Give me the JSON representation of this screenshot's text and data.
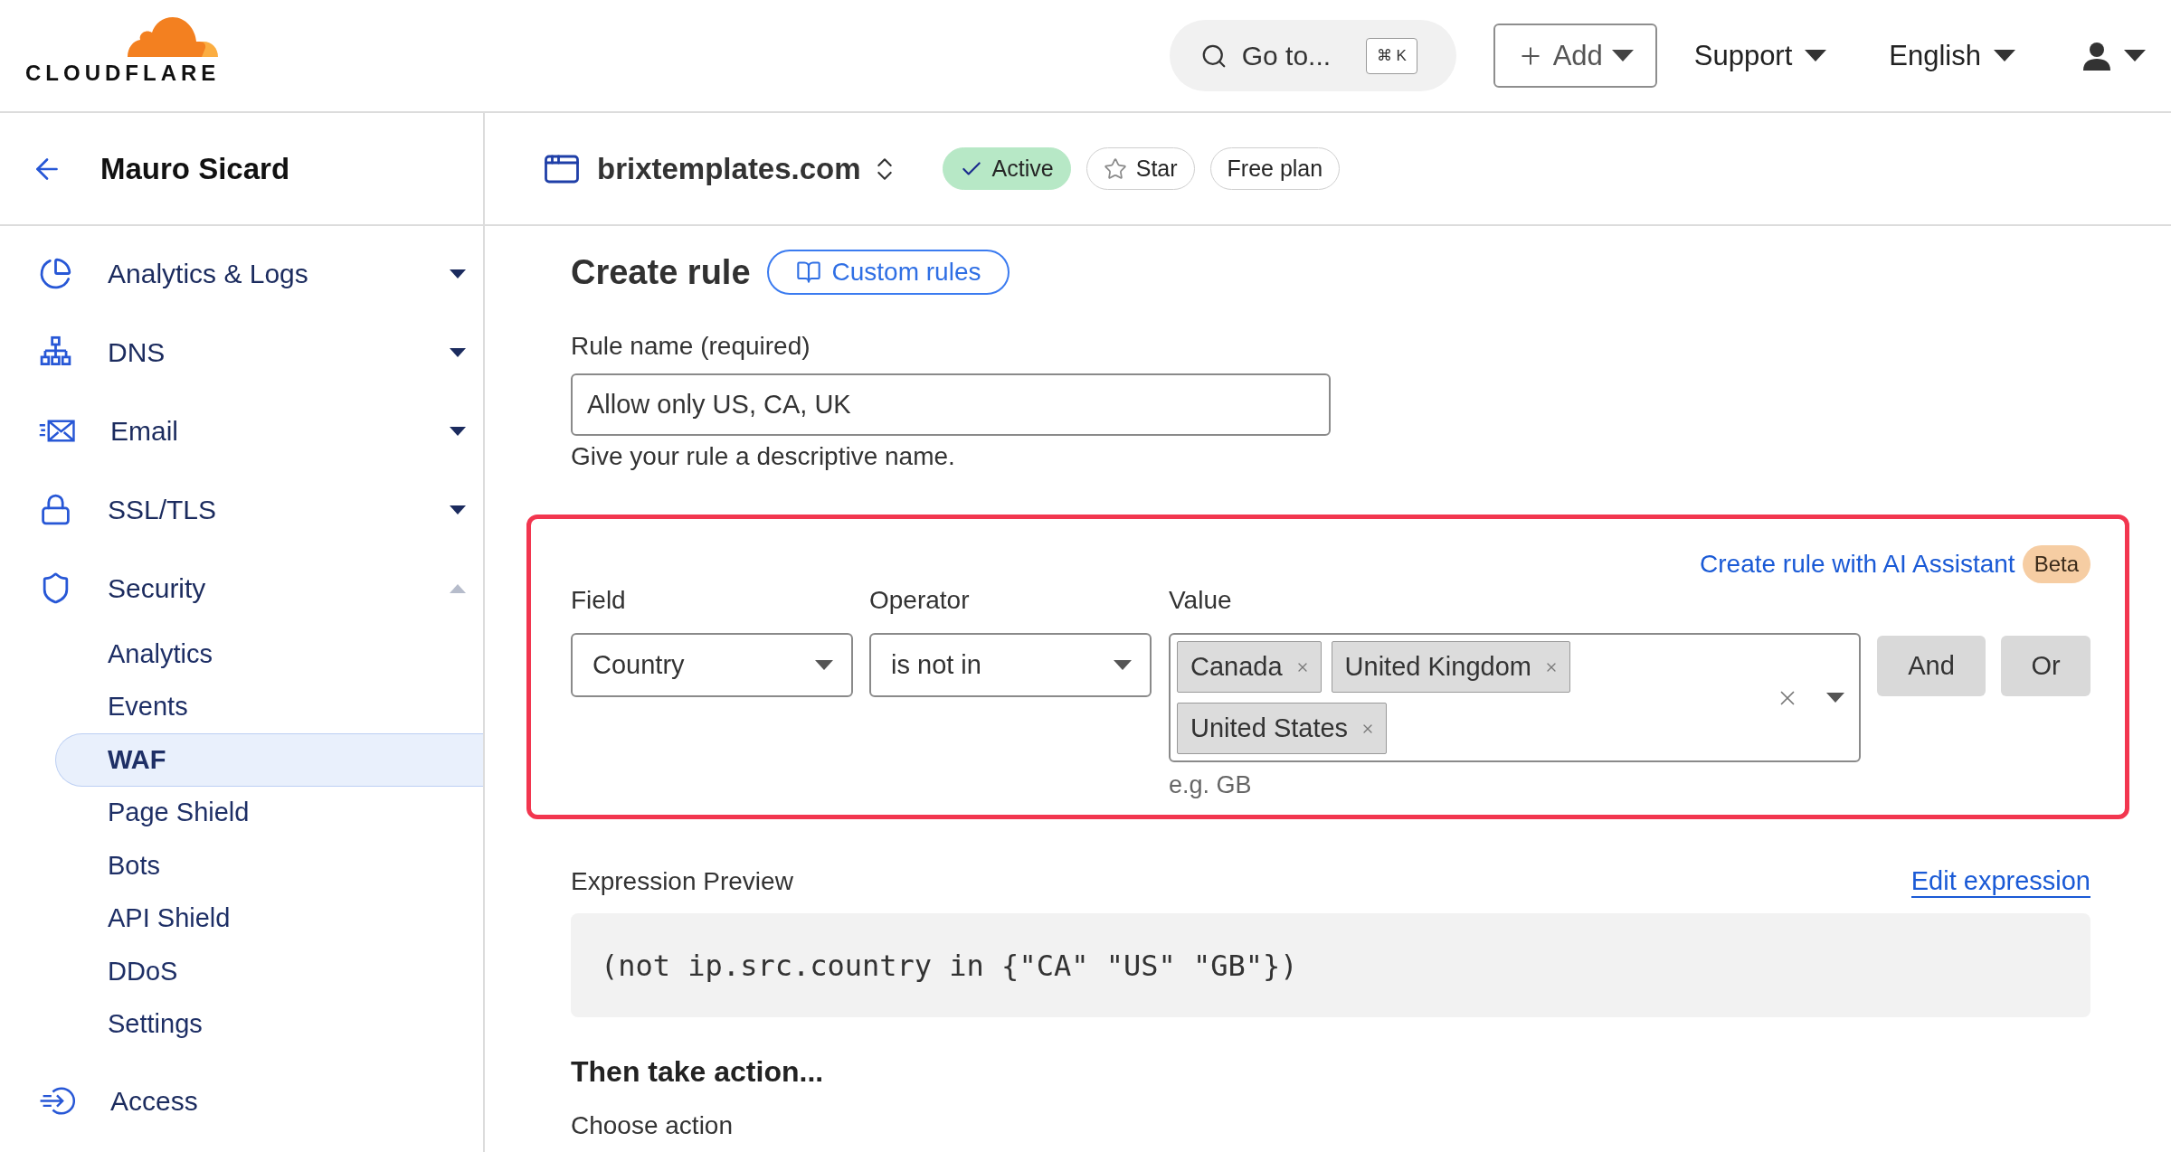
{
  "top_bar": {
    "logo_text": "CLOUDFLARE",
    "search": {
      "label": "Go to...",
      "shortcut": "⌘ K"
    },
    "add_button": "Add",
    "menus": [
      "Support",
      "English"
    ]
  },
  "sidebar": {
    "account": "Mauro Sicard",
    "items": [
      {
        "label": "Analytics & Logs",
        "expanded": false
      },
      {
        "label": "DNS",
        "expanded": false
      },
      {
        "label": "Email",
        "expanded": false
      },
      {
        "label": "SSL/TLS",
        "expanded": false
      },
      {
        "label": "Security",
        "expanded": true,
        "children": [
          {
            "label": "Analytics",
            "selected": false
          },
          {
            "label": "Events",
            "selected": false
          },
          {
            "label": "WAF",
            "selected": true
          },
          {
            "label": "Page Shield",
            "selected": false
          },
          {
            "label": "Bots",
            "selected": false
          },
          {
            "label": "API Shield",
            "selected": false
          },
          {
            "label": "DDoS",
            "selected": false
          },
          {
            "label": "Settings",
            "selected": false
          }
        ]
      },
      {
        "label": "Access"
      }
    ]
  },
  "site_header": {
    "site": "brixtemplates.com",
    "badges": [
      {
        "label": "Active",
        "kind": "status"
      },
      {
        "label": "Star",
        "kind": "star"
      },
      {
        "label": "Free plan",
        "kind": "plan"
      }
    ]
  },
  "form": {
    "title": "Create rule",
    "docs_link": "Custom rules",
    "rule_name": {
      "label": "Rule name (required)",
      "value": "Allow only US, CA, UK",
      "help": "Give your rule a descriptive name."
    },
    "builder": {
      "ai_link": "Create rule with AI Assistant",
      "ai_badge": "Beta",
      "field": {
        "label": "Field",
        "value": "Country"
      },
      "operator": {
        "label": "Operator",
        "value": "is not in"
      },
      "value": {
        "label": "Value",
        "tags": [
          "Canada",
          "United Kingdom",
          "United States"
        ],
        "hint": "e.g. GB"
      },
      "logic_buttons": [
        "And",
        "Or"
      ]
    },
    "expression": {
      "label": "Expression Preview",
      "edit_link": "Edit expression",
      "code": "(not ip.src.country in {\"CA\" \"US\" \"GB\"})"
    },
    "action": {
      "heading": "Then take action...",
      "label": "Choose action"
    }
  }
}
